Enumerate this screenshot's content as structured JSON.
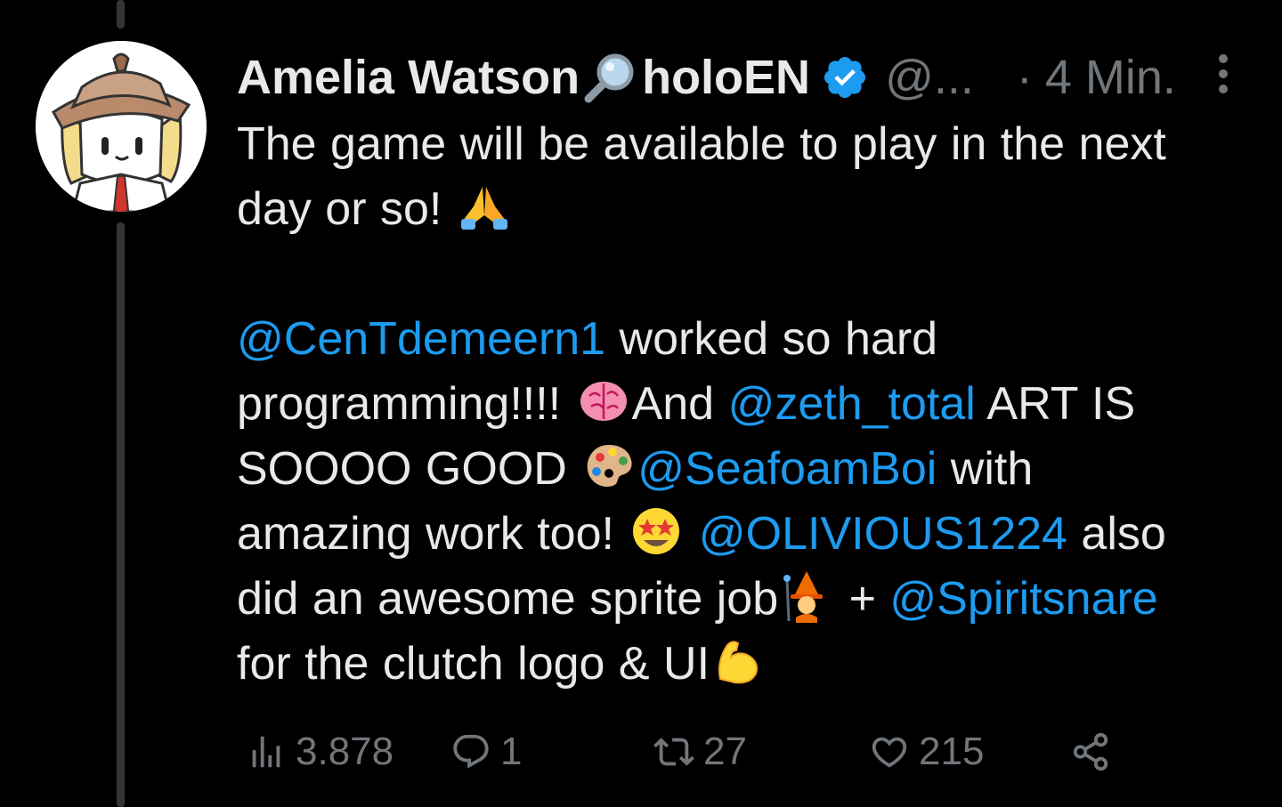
{
  "tweet": {
    "author": {
      "display_name": "Amelia Watson",
      "display_name_suffix": "holoEN",
      "name_icon": "magnifying-glass-icon",
      "verified_icon": "verified-badge-icon",
      "handle": "@...",
      "separator": "·",
      "time": "4 Min."
    },
    "lines": [
      [
        {
          "t": "The game will be available to play in the next"
        }
      ],
      [
        {
          "t": "day or so! "
        },
        {
          "emoji": "folded-hands-emoji"
        }
      ],
      [],
      [
        {
          "t": "@CenTdemeern1",
          "mention": true
        },
        {
          "t": " worked so hard"
        }
      ],
      [
        {
          "t": "programming!!!! "
        },
        {
          "emoji": "brain-emoji"
        },
        {
          "t": "And "
        },
        {
          "t": "@zeth_total",
          "mention": true
        },
        {
          "t": " ART IS"
        }
      ],
      [
        {
          "t": "SOOOO GOOD "
        },
        {
          "emoji": "palette-emoji"
        },
        {
          "t": "@SeafoamBoi",
          "mention": true
        },
        {
          "t": " with"
        }
      ],
      [
        {
          "t": "amazing work too! "
        },
        {
          "emoji": "star-struck-emoji"
        },
        {
          "t": " "
        },
        {
          "t": "@OLIVIOUS1224",
          "mention": true
        },
        {
          "t": "  also"
        }
      ],
      [
        {
          "t": "did an awesome sprite job"
        },
        {
          "emoji": "mage-emoji"
        },
        {
          "t": " + "
        },
        {
          "t": "@Spiritsnare",
          "mention": true
        }
      ],
      [
        {
          "t": "for the clutch logo & UI"
        },
        {
          "emoji": "flexed-biceps-emoji"
        }
      ]
    ],
    "actions": {
      "views": "3.878",
      "replies": "1",
      "retweets": "27",
      "likes": "215"
    }
  },
  "colors": {
    "background": "#000000",
    "text": "#e7e9ea",
    "secondary": "#71767b",
    "mention": "#1d9bf0",
    "verified": "#1d9bf0",
    "thread_line": "#333639"
  }
}
